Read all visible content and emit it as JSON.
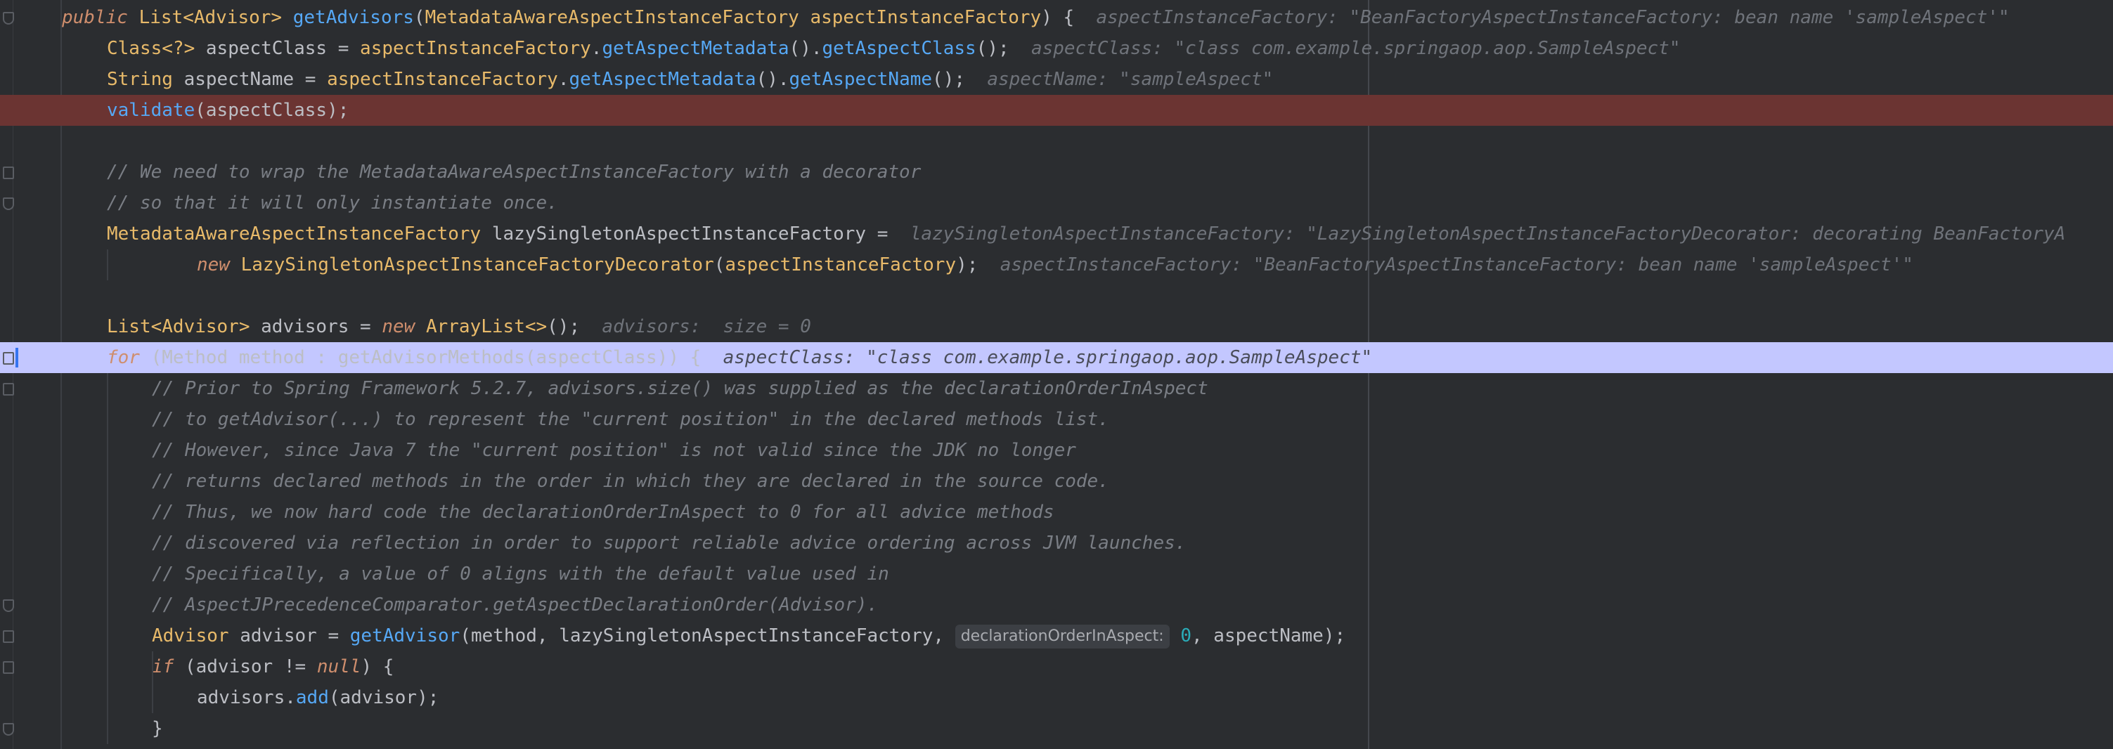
{
  "lines": [
    {
      "indent": 0,
      "tokens": [
        [
          "kwi",
          "public"
        ],
        [
          "pun",
          " "
        ],
        [
          "ty",
          "List<Advisor>"
        ],
        [
          "pun",
          " "
        ],
        [
          "fn",
          "getAdvisors"
        ],
        [
          "pun",
          "("
        ],
        [
          "ty",
          "MetadataAwareAspectInstanceFactory"
        ],
        [
          "pun",
          " "
        ],
        [
          "pr",
          "aspectInstanceFactory"
        ],
        [
          "pun",
          ") {"
        ]
      ],
      "hint": "aspectInstanceFactory: \"BeanFactoryAspectInstanceFactory: bean name 'sampleAspect'\""
    },
    {
      "indent": 1,
      "tokens": [
        [
          "ty",
          "Class<?>"
        ],
        [
          "pun",
          " aspectClass = "
        ],
        [
          "pr",
          "aspectInstanceFactory"
        ],
        [
          "pun",
          "."
        ],
        [
          "fn",
          "getAspectMetadata"
        ],
        [
          "pun",
          "()."
        ],
        [
          "fn",
          "getAspectClass"
        ],
        [
          "pun",
          "();"
        ]
      ],
      "hint": "aspectClass: \"class com.example.springaop.aop.SampleAspect\""
    },
    {
      "indent": 1,
      "tokens": [
        [
          "ty",
          "String"
        ],
        [
          "pun",
          " aspectName = "
        ],
        [
          "pr",
          "aspectInstanceFactory"
        ],
        [
          "pun",
          "."
        ],
        [
          "fn",
          "getAspectMetadata"
        ],
        [
          "pun",
          "()."
        ],
        [
          "fn",
          "getAspectName"
        ],
        [
          "pun",
          "();"
        ]
      ],
      "hint": "aspectName: \"sampleAspect\""
    },
    {
      "indent": 1,
      "tokens": [
        [
          "fn",
          "validate"
        ],
        [
          "pun",
          "(aspectClass);"
        ]
      ],
      "hint": ""
    },
    {
      "indent": 0,
      "tokens": [],
      "hint": ""
    },
    {
      "indent": 1,
      "tokens": [
        [
          "cm",
          "// We need to wrap the MetadataAwareAspectInstanceFactory with a decorator"
        ]
      ],
      "hint": ""
    },
    {
      "indent": 1,
      "tokens": [
        [
          "cm",
          "// so that it will only instantiate once."
        ]
      ],
      "hint": ""
    },
    {
      "indent": 1,
      "tokens": [
        [
          "ty",
          "MetadataAwareAspectInstanceFactory"
        ],
        [
          "pun",
          " lazySingletonAspectInstanceFactory ="
        ]
      ],
      "hint": "lazySingletonAspectInstanceFactory: \"LazySingletonAspectInstanceFactoryDecorator: decorating BeanFactoryA"
    },
    {
      "indent": 3,
      "tokens": [
        [
          "kwi",
          "new"
        ],
        [
          "pun",
          " "
        ],
        [
          "ty",
          "LazySingletonAspectInstanceFactoryDecorator"
        ],
        [
          "pun",
          "("
        ],
        [
          "pr",
          "aspectInstanceFactory"
        ],
        [
          "pun",
          ");"
        ]
      ],
      "hint": "aspectInstanceFactory: \"BeanFactoryAspectInstanceFactory: bean name 'sampleAspect'\""
    },
    {
      "indent": 0,
      "tokens": [],
      "hint": ""
    },
    {
      "indent": 1,
      "tokens": [
        [
          "ty",
          "List<Advisor>"
        ],
        [
          "pun",
          " advisors = "
        ],
        [
          "kwi",
          "new"
        ],
        [
          "pun",
          " "
        ],
        [
          "ty",
          "ArrayList<>"
        ],
        [
          "pun",
          "();"
        ]
      ],
      "hint": "advisors:  size = 0"
    },
    {
      "indent": 1,
      "tokens": [
        [
          "kwi",
          "for"
        ],
        [
          "pun",
          " (Method method : getAdvisorMethods(aspectClass)) {"
        ]
      ],
      "hint": "aspectClass: \"class com.example.springaop.aop.SampleAspect\""
    },
    {
      "indent": 2,
      "tokens": [
        [
          "cm",
          "// Prior to Spring Framework 5.2.7, advisors.size() was supplied as the declarationOrderInAspect"
        ]
      ],
      "hint": ""
    },
    {
      "indent": 2,
      "tokens": [
        [
          "cm",
          "// to getAdvisor(...) to represent the \"current position\" in the declared methods list."
        ]
      ],
      "hint": ""
    },
    {
      "indent": 2,
      "tokens": [
        [
          "cm",
          "// However, since Java 7 the \"current position\" is not valid since the JDK no longer"
        ]
      ],
      "hint": ""
    },
    {
      "indent": 2,
      "tokens": [
        [
          "cm",
          "// returns declared methods in the order in which they are declared in the source code."
        ]
      ],
      "hint": ""
    },
    {
      "indent": 2,
      "tokens": [
        [
          "cm",
          "// Thus, we now hard code the declarationOrderInAspect to 0 for all advice methods"
        ]
      ],
      "hint": ""
    },
    {
      "indent": 2,
      "tokens": [
        [
          "cm",
          "// discovered via reflection in order to support reliable advice ordering across JVM launches."
        ]
      ],
      "hint": ""
    },
    {
      "indent": 2,
      "tokens": [
        [
          "cm",
          "// Specifically, a value of 0 aligns with the default value used in"
        ]
      ],
      "hint": ""
    },
    {
      "indent": 2,
      "tokens": [
        [
          "cm",
          "// AspectJPrecedenceComparator.getAspectDeclarationOrder(Advisor)."
        ]
      ],
      "hint": ""
    },
    {
      "indent": 2,
      "tokens": [
        [
          "ty",
          "Advisor"
        ],
        [
          "pun",
          " advisor = "
        ],
        [
          "fn",
          "getAdvisor"
        ],
        [
          "pun",
          "(method, lazySingletonAspectInstanceFactory, "
        ],
        [
          "inlay",
          "declarationOrderInAspect:"
        ],
        [
          "num",
          " 0"
        ],
        [
          "pun",
          ", aspectName);"
        ]
      ],
      "hint": ""
    },
    {
      "indent": 2,
      "tokens": [
        [
          "kwi",
          "if"
        ],
        [
          "pun",
          " (advisor != "
        ],
        [
          "kwi",
          "null"
        ],
        [
          "pun",
          ") {"
        ]
      ],
      "hint": ""
    },
    {
      "indent": 3,
      "tokens": [
        [
          "pun",
          "advisors."
        ],
        [
          "fn",
          "add"
        ],
        [
          "pun",
          "(advisor);"
        ]
      ],
      "hint": ""
    },
    {
      "indent": 2,
      "tokens": [
        [
          "pun",
          "}"
        ]
      ],
      "hint": ""
    }
  ],
  "execution_line_index": 3,
  "current_line_index": 11,
  "colors": {
    "background": "#2b2d30",
    "execution_highlight": "#6b3432",
    "current_line": "#c3c7ff",
    "keyword": "#cf8e6d",
    "type": "#e8ba6a",
    "method": "#56a8f5",
    "comment": "#7a7e85",
    "number": "#2aacb8"
  }
}
